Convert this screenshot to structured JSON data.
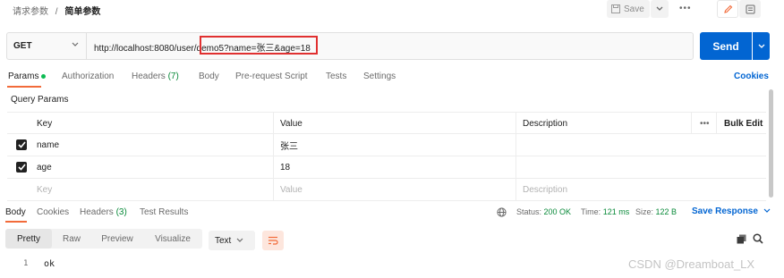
{
  "breadcrumb": {
    "parent": "请求参数",
    "separator": "/",
    "current": "简单参数"
  },
  "toolbar": {
    "save_label": "Save",
    "more_label": "•••"
  },
  "request": {
    "method": "GET",
    "url_prefix": "http://localhost:8080/user/",
    "url_highlighted": "demo5?name=张三&age=18",
    "send_label": "Send"
  },
  "request_tabs": [
    {
      "label": "Params",
      "active": true
    },
    {
      "label": "Authorization"
    },
    {
      "label": "Headers",
      "count": "(7)"
    },
    {
      "label": "Body"
    },
    {
      "label": "Pre-request Script"
    },
    {
      "label": "Tests"
    },
    {
      "label": "Settings"
    }
  ],
  "cookies_label": "Cookies",
  "query_params": {
    "title": "Query Params",
    "headers": {
      "key": "Key",
      "value": "Value",
      "description": "Description",
      "more": "•••",
      "bulk_edit": "Bulk Edit"
    },
    "rows": [
      {
        "key": "name",
        "value": "张三",
        "checked": true
      },
      {
        "key": "age",
        "value": "18",
        "checked": true
      }
    ],
    "placeholders": {
      "key": "Key",
      "value": "Value",
      "description": "Description"
    }
  },
  "response": {
    "tabs": [
      {
        "label": "Body",
        "active": true
      },
      {
        "label": "Cookies"
      },
      {
        "label": "Headers",
        "count": "(3)"
      },
      {
        "label": "Test Results"
      }
    ],
    "status_label": "Status:",
    "status_value": "200 OK",
    "time_label": "Time:",
    "time_value": "121 ms",
    "size_label": "Size:",
    "size_value": "122 B",
    "save_response_label": "Save Response",
    "view_modes": [
      "Pretty",
      "Raw",
      "Preview",
      "Visualize"
    ],
    "active_view": "Pretty",
    "format": "Text",
    "body_lines": [
      {
        "line_no": "1",
        "text": "ok"
      }
    ]
  },
  "watermark": "CSDN @Dreamboat_LX",
  "colors": {
    "accent": "#f26b3a",
    "primary": "#0265d2",
    "highlight_border": "#e03030",
    "status_ok": "#0a8a3a"
  }
}
